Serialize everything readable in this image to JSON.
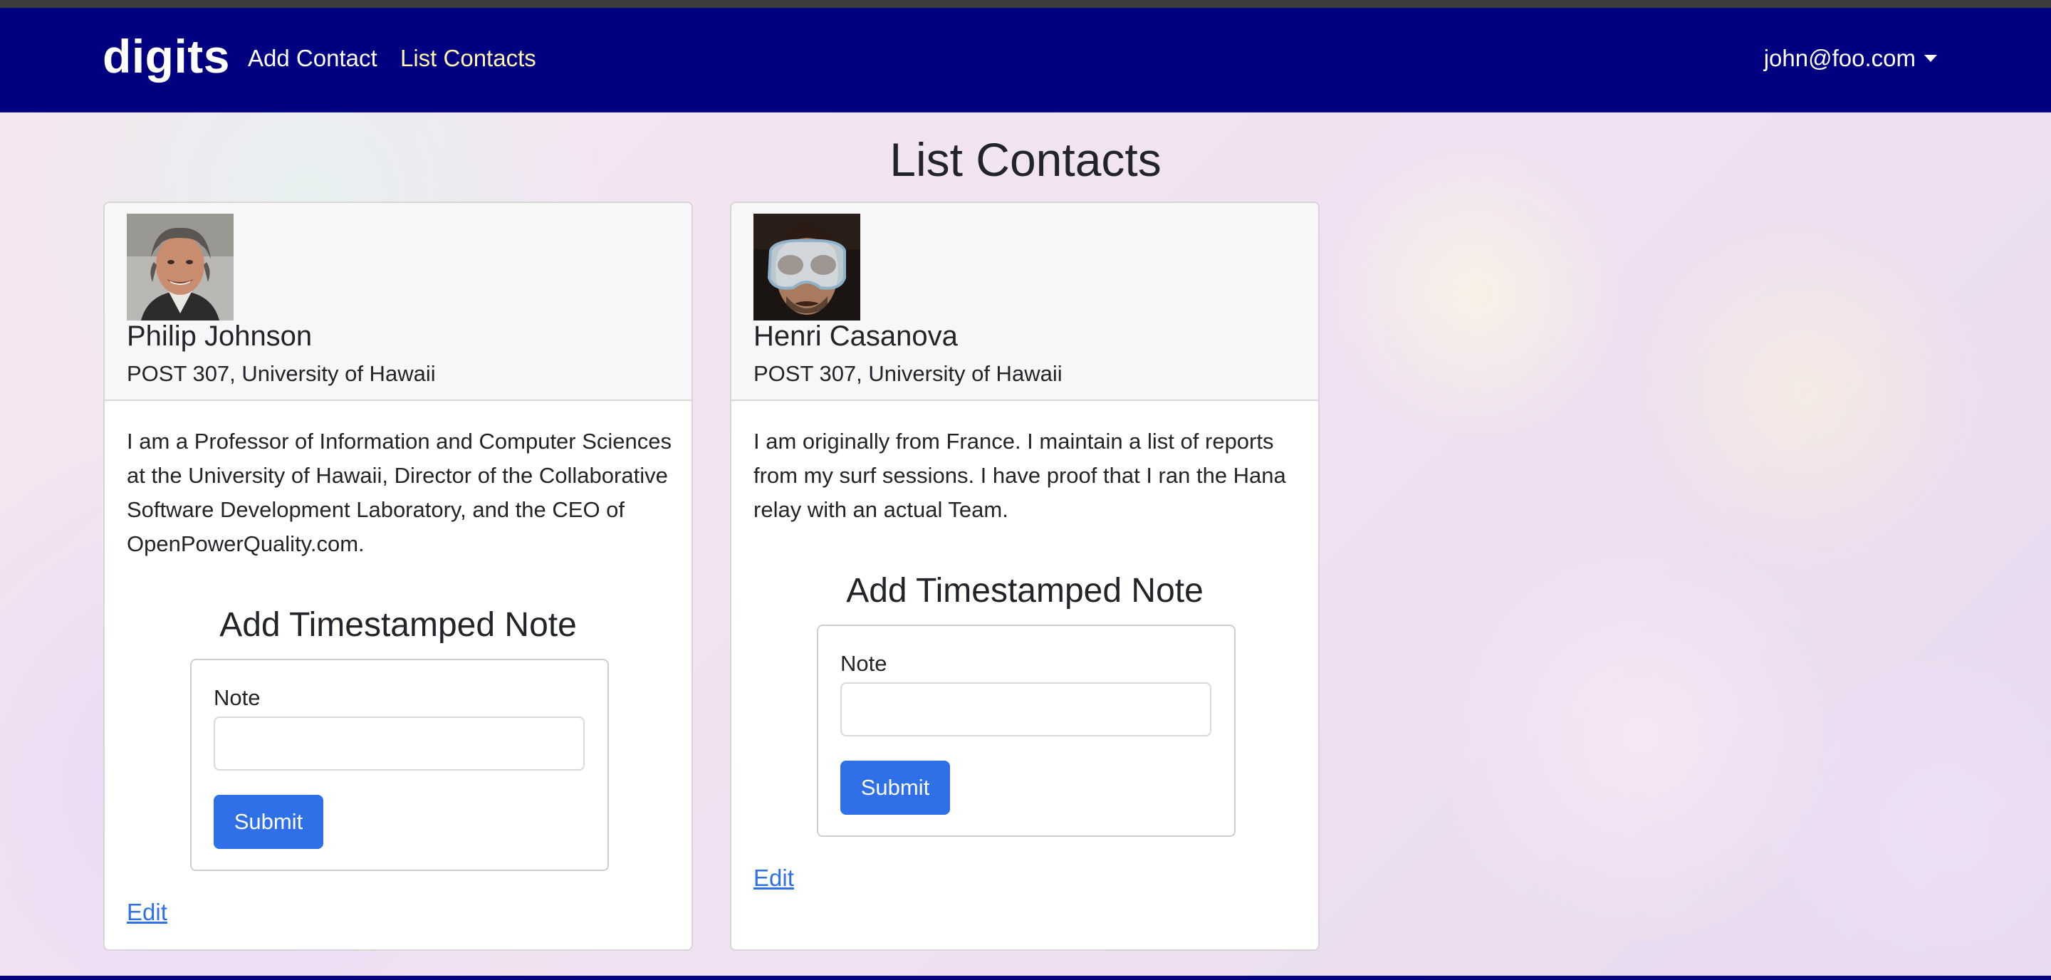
{
  "navbar": {
    "brand": "digits",
    "links": [
      "Add Contact",
      "List Contacts"
    ],
    "user": "john@foo.com"
  },
  "page": {
    "title": "List Contacts"
  },
  "contacts": [
    {
      "name": "Philip Johnson",
      "address": "POST 307, University of Hawaii",
      "description": "I am a Professor of Information and Computer Sciences at the University of Hawaii, Director of the Collaborative Software Development Laboratory, and the CEO of OpenPowerQuality.com.",
      "note_title": "Add Timestamped Note",
      "note_label": "Note",
      "note_value": "",
      "submit_label": "Submit",
      "edit_label": "Edit"
    },
    {
      "name": "Henri Casanova",
      "address": "POST 307, University of Hawaii",
      "description": "I am originally from France. I maintain a list of reports from my surf sessions. I have proof that I ran the Hana relay with an actual Team.",
      "note_title": "Add Timestamped Note",
      "note_label": "Note",
      "note_value": "",
      "submit_label": "Submit",
      "edit_label": "Edit"
    }
  ],
  "colors": {
    "navbar_bg": "#000080",
    "active_link": "#fff4a8",
    "button": "#2f6fe8",
    "link": "#2f6fe8"
  }
}
